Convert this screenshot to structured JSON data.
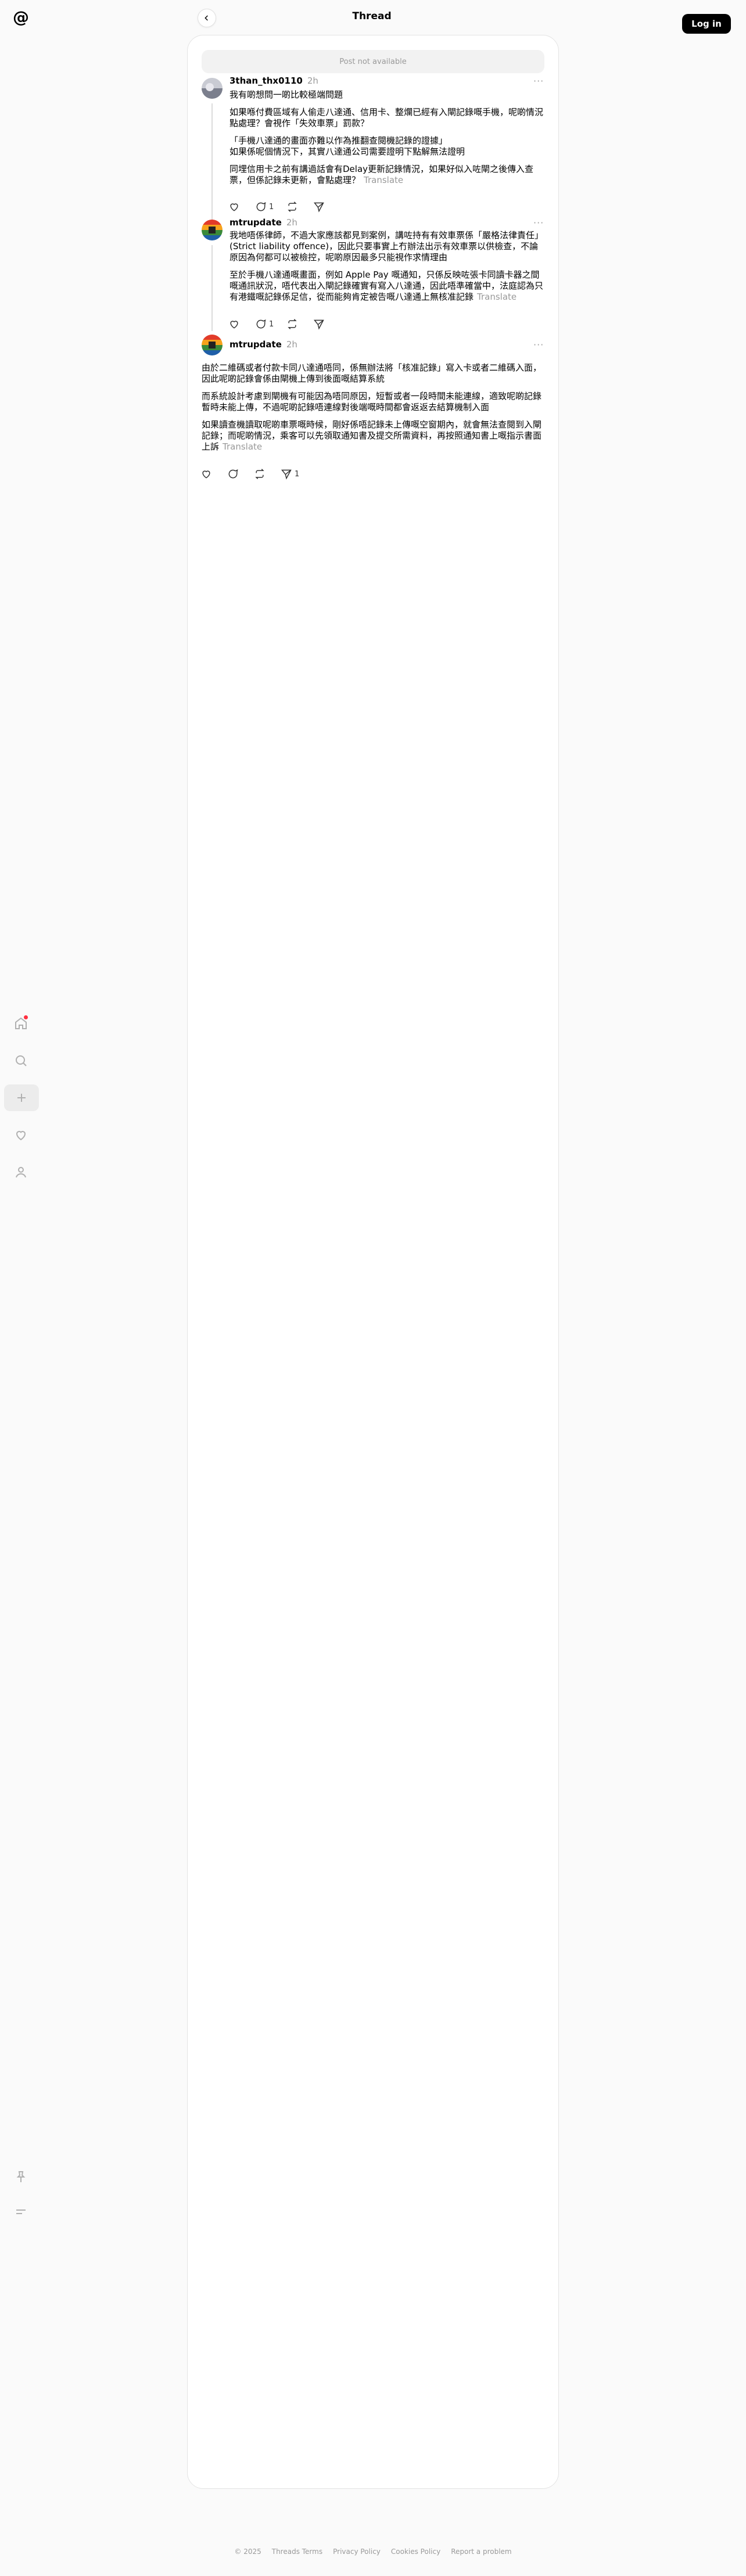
{
  "header": {
    "title": "Thread",
    "login_label": "Log in"
  },
  "unavailable_text": "Post not available",
  "posts": [
    {
      "username": "3than_thx0110",
      "time": "2h",
      "paragraphs": [
        "我有啲想問一啲比較極端問題",
        "如果喺付費區域有人偷走八達通、信用卡、整爛已經有入閘記錄嘅手機，呢啲情況點處理？會視作「失效車票」罰款？",
        "「手機八達通的畫面亦難以作為推翻查閱機記錄的證據」\n如果係呢個情況下，其實八達通公司需要證明下點解無法證明",
        "同埋信用卡之前有講過話會有Delay更新記錄情況，如果好似入咗閘之後傳入查票，但係記錄未更新，會點處理？"
      ],
      "translate": "Translate",
      "replies": "1",
      "reposts": "",
      "shares": ""
    },
    {
      "username": "mtrupdate",
      "time": "2h",
      "paragraphs": [
        "我地唔係律師，不過大家應該都見到案例，講咗持有有效車票係「嚴格法律責任」(Strict liability offence)，因此只要事實上冇辦法出示有效車票以供檢查，不論原因為何都可以被檢控，呢啲原因最多只能視作求情理由",
        "至於手機八達通嘅畫面，例如 Apple Pay 嘅通知，只係反映咗張卡同讀卡器之間嘅通訊狀況，唔代表出入閘記錄確實有寫入八達通，因此唔準確當中，法庭認為只有港鐵嘅記錄係足信，從而能夠肯定被告嘅八達通上無核准記錄"
      ],
      "translate": "Translate",
      "replies": "1",
      "reposts": "",
      "shares": ""
    },
    {
      "username": "mtrupdate",
      "time": "2h",
      "paragraphs": [
        "由於二維碼或者付款卡同八達通唔同，係無辦法將「核准記錄」寫入卡或者二維碼入面，因此呢啲記錄會係由閘機上傳到後面嘅結算系統",
        "而系統設計考慮到閘機有可能因為唔同原因，短暫或者一段時間未能連線，適致呢啲記錄暫時未能上傳，不過呢啲記錄唔連線對後端嘅時間都會返返去結算機制入面",
        "如果讀查機讀取呢啲車票嘅時候，剛好係唔記錄未上傳嘅空窗期內，就會無法查閱到入閘記錄；而呢啲情況，乘客可以先領取通知書及提交所需資料，再按照通知書上嘅指示書面上訴"
      ],
      "translate": "Translate",
      "replies": "",
      "reposts": "",
      "shares": "1"
    }
  ],
  "nav": {
    "items": [
      "home-icon",
      "search-icon",
      "create-icon",
      "heart-icon",
      "profile-icon",
      "pin-icon",
      "menu-icon"
    ]
  },
  "footer": {
    "copyright": "© 2025",
    "links": [
      "Threads Terms",
      "Privacy Policy",
      "Cookies Policy",
      "Report a problem"
    ]
  }
}
